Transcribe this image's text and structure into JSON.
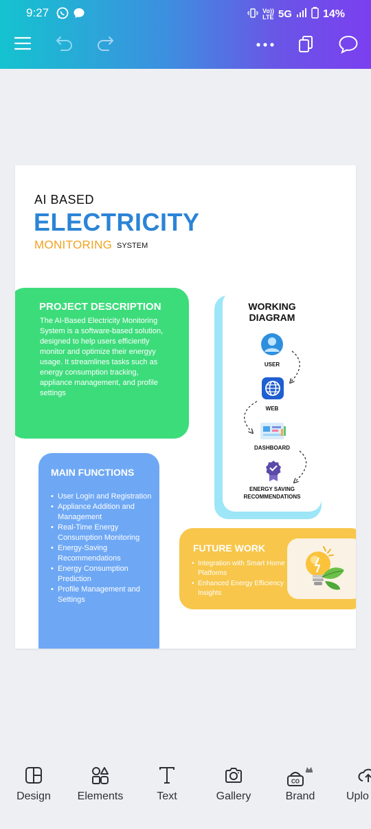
{
  "status_bar": {
    "time": "9:27",
    "network_top": "Vo))",
    "network_bottom": "LTE",
    "network_type": "5G",
    "battery": "14%"
  },
  "toolbar": {
    "icons": [
      "menu-icon",
      "undo-icon",
      "redo-icon",
      "more-icon",
      "pages-icon",
      "comment-icon"
    ]
  },
  "poster": {
    "title_line1": "AI BASED",
    "title_line2": "ELECTRICITY",
    "title_line3a": "MONITORING",
    "title_line3b": "SYSTEM",
    "project": {
      "heading": "PROJECT DESCRIPTION",
      "body": "The AI-Based Electricity Monitoring System is a software-based solution, designed to help users efficiently monitor and optimize their energyy usage. It streamlines tasks such as energy consumption tracking, appliance management, and profile settings"
    },
    "diagram": {
      "title_line1": "WORKING",
      "title_line2": "DIAGRAM",
      "nodes": [
        "USER",
        "WEB",
        "DASHBOARD",
        "ENERGY SAVING",
        "RECOMMENDATIONS"
      ]
    },
    "main_functions": {
      "heading": "MAIN FUNCTIONS",
      "items": [
        "User Login and Registration",
        "Appliance Addition and Management",
        "Real-Time Energy Consumption Monitoring",
        "Energy-Saving Recommendations",
        "Energy Consumption Prediction",
        "Profile Management and Settings"
      ]
    },
    "future_work": {
      "heading": "FUTURE WORK",
      "items": [
        "Integration with Smart Home Platforms",
        "Enhanced Energy Efficiency Insights"
      ]
    }
  },
  "bottom_nav": {
    "items": [
      "Design",
      "Elements",
      "Text",
      "Gallery",
      "Brand",
      "Uplo"
    ]
  },
  "colors": {
    "accent_blue": "#2b84d6",
    "accent_orange": "#f0a21f",
    "green": "#3ddc7b",
    "blue_card": "#6ea8f5",
    "yellow_card": "#f7c64a"
  }
}
